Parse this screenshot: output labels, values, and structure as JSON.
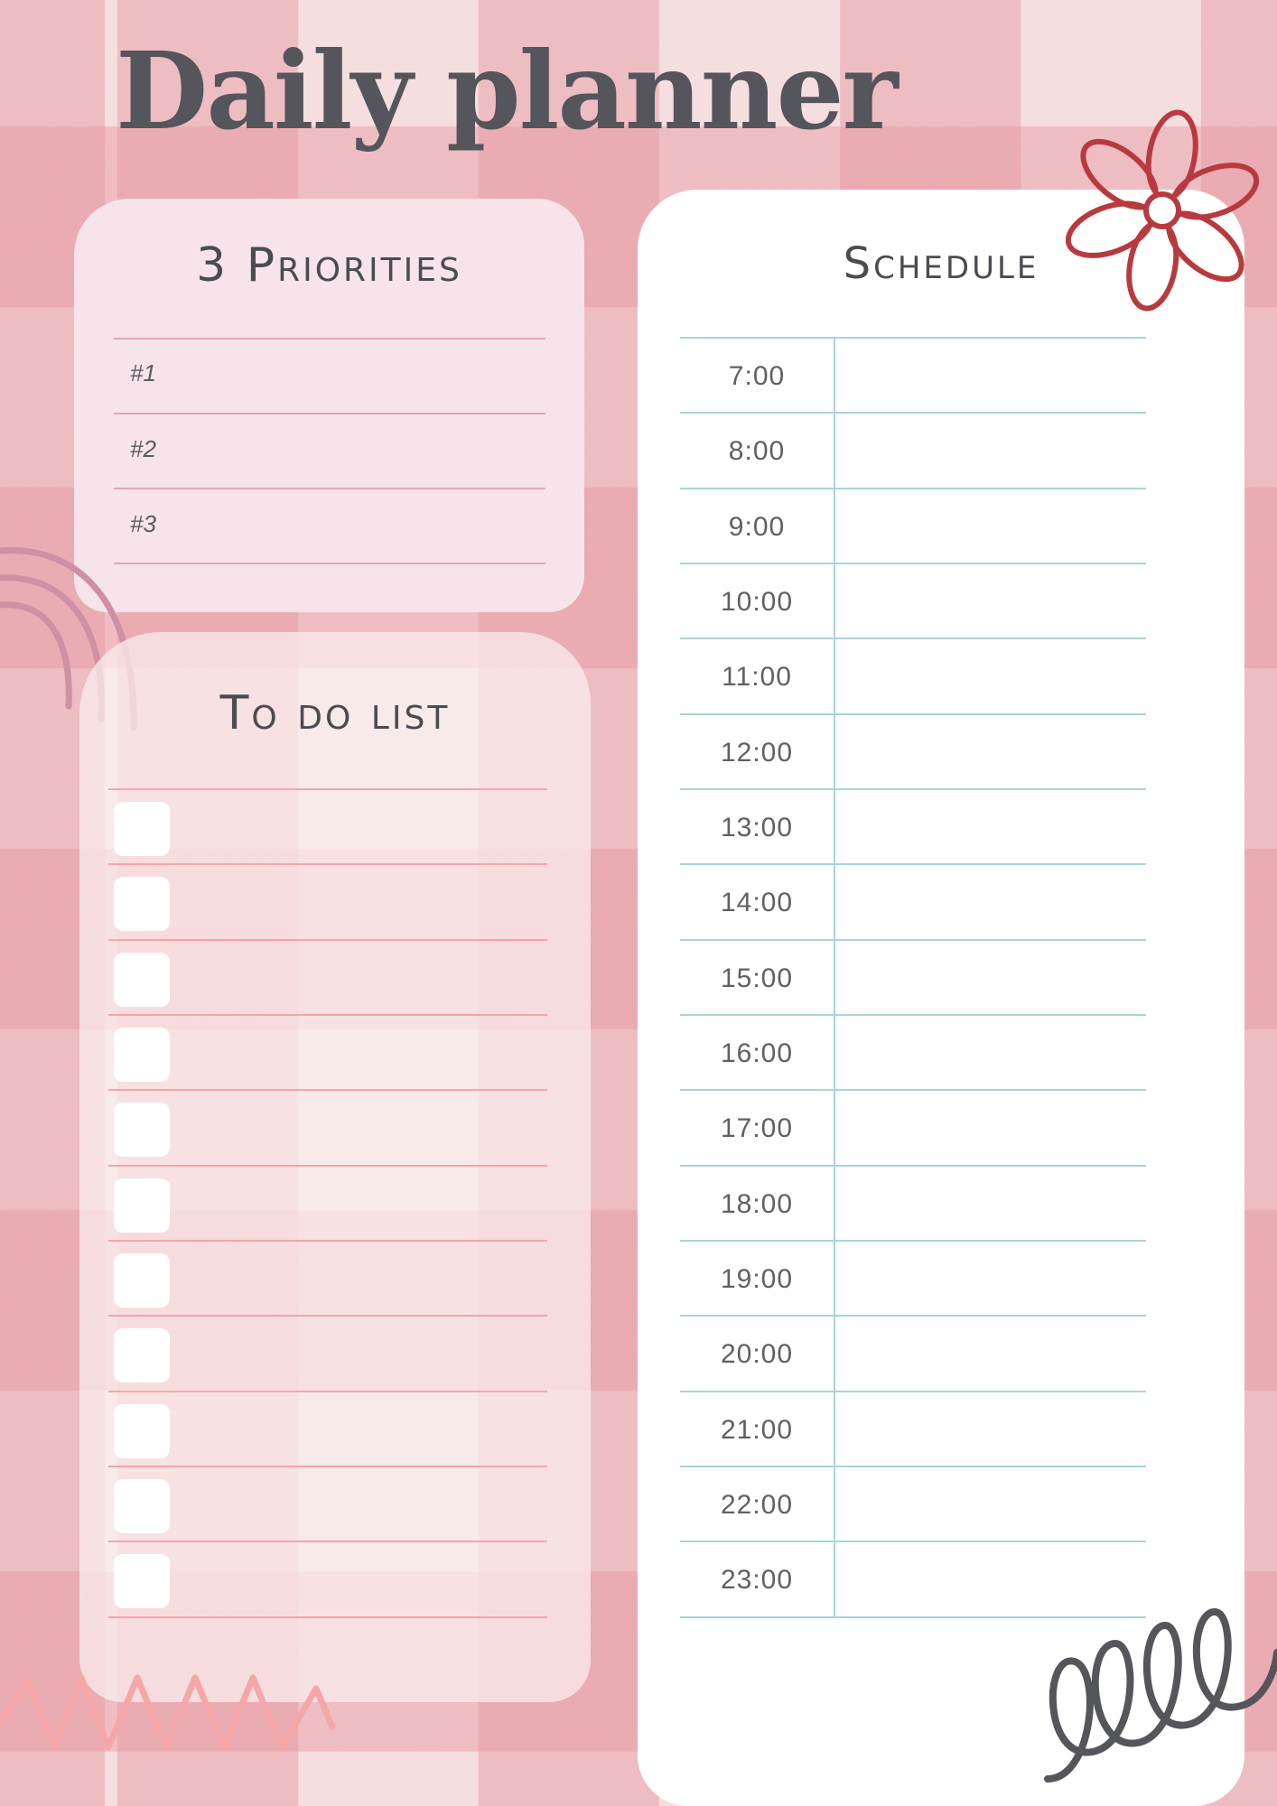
{
  "title": "Daily planner",
  "priorities": {
    "title": "3 Priorities",
    "items": [
      "#1",
      "#2",
      "#3"
    ]
  },
  "todo": {
    "title": "To do list",
    "item_count": 11
  },
  "schedule": {
    "title": "Schedule",
    "times": [
      "7:00",
      "8:00",
      "9:00",
      "10:00",
      "11:00",
      "12:00",
      "13:00",
      "14:00",
      "15:00",
      "16:00",
      "17:00",
      "18:00",
      "19:00",
      "20:00",
      "21:00",
      "22:00",
      "23:00"
    ]
  },
  "colors": {
    "title_text": "#55555c",
    "priority_lines": "#e4a6b6",
    "todo_lines": "#f2a6a9",
    "schedule_lines": "#a9d4d9",
    "flower": "#b83a3e",
    "rainbow": "#cf8fa5",
    "zigzag": "#f5a7a7",
    "spiral": "#55555c"
  },
  "decorations": [
    "flower-icon",
    "rainbow-icon",
    "zigzag-icon",
    "spiral-icon"
  ]
}
